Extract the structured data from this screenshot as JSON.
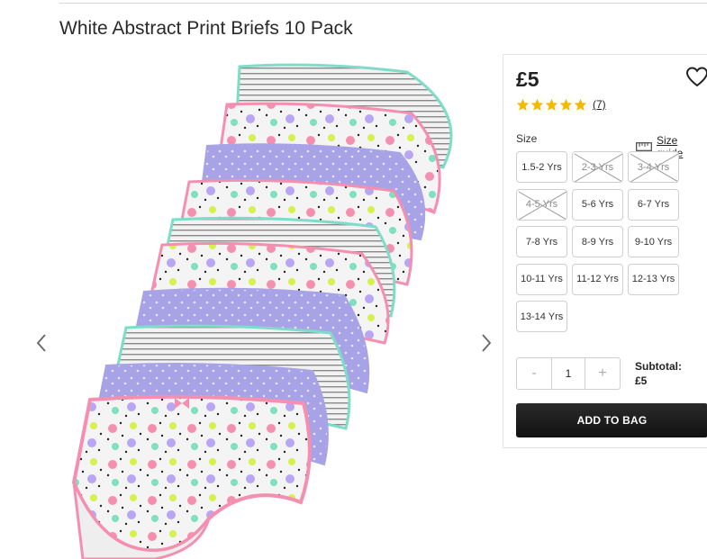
{
  "product": {
    "title": "White Abstract Print Briefs 10 Pack",
    "price": "£5",
    "rating": 5,
    "rating_max": 5,
    "review_count": "(7)"
  },
  "colors": {
    "star": "#f5b800",
    "button_bg": "#1f1f1f",
    "border": "#cfcfcf"
  },
  "icons": {
    "wishlist": "heart-icon",
    "size_guide": "ruler-icon",
    "prev": "chevron-left-icon",
    "next": "chevron-right-icon"
  },
  "size": {
    "label": "Size",
    "guide_label": "Size guide",
    "options": [
      {
        "label": "1.5-2 Yrs",
        "available": true
      },
      {
        "label": "2-3 Yrs",
        "available": false
      },
      {
        "label": "3-4 Yrs",
        "available": false
      },
      {
        "label": "4-5 Yrs",
        "available": false
      },
      {
        "label": "5-6 Yrs",
        "available": true
      },
      {
        "label": "6-7 Yrs",
        "available": true
      },
      {
        "label": "7-8 Yrs",
        "available": true
      },
      {
        "label": "8-9 Yrs",
        "available": true
      },
      {
        "label": "9-10 Yrs",
        "available": true
      },
      {
        "label": "10-11 Yrs",
        "available": true
      },
      {
        "label": "11-12 Yrs",
        "available": true
      },
      {
        "label": "12-13 Yrs",
        "available": true
      },
      {
        "label": "13-14 Yrs",
        "available": true
      }
    ]
  },
  "quantity": {
    "minus": "-",
    "value": "1",
    "plus": "+"
  },
  "subtotal": {
    "label": "Subtotal:",
    "value": "£5"
  },
  "cta": {
    "add_to_bag": "ADD TO BAG"
  }
}
